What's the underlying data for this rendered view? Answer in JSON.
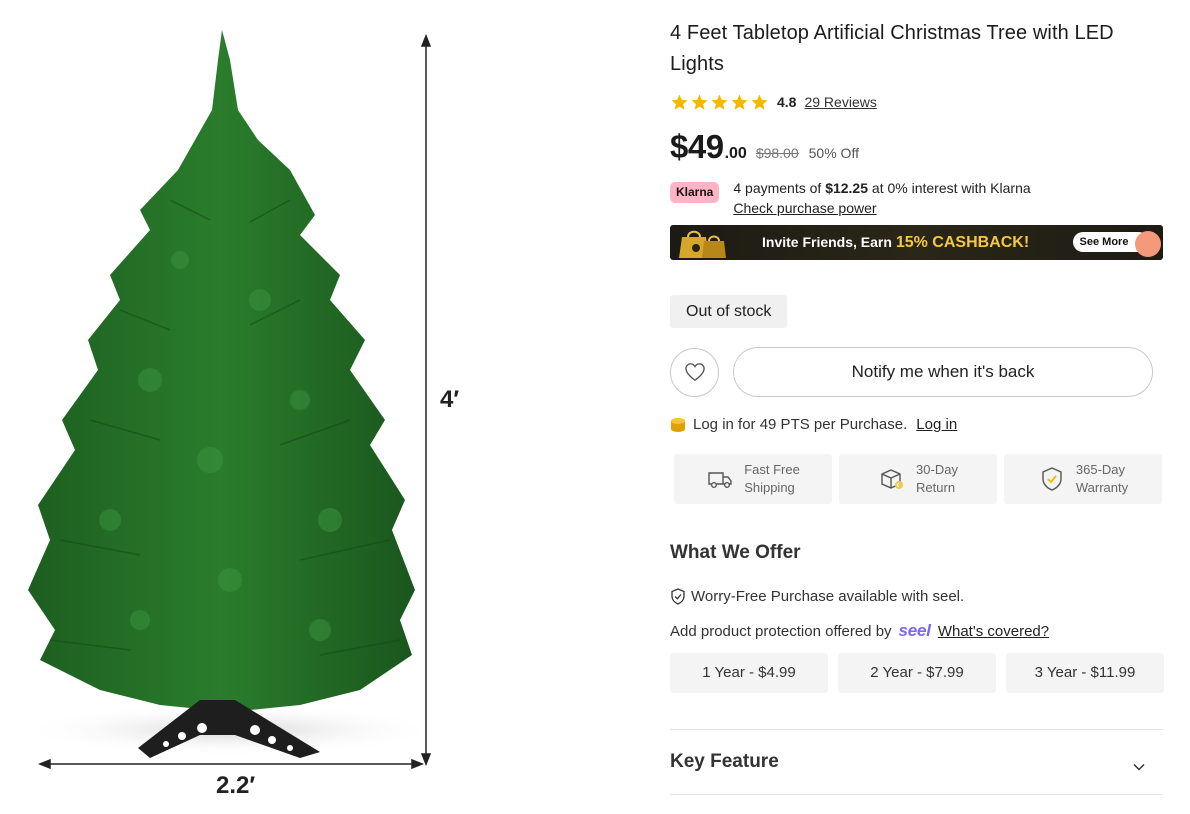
{
  "image": {
    "height_label": "4′",
    "width_label": "2.2′"
  },
  "product": {
    "title": "4 Feet Tabletop Artificial Christmas Tree with LED Lights",
    "rating": "4.8",
    "rating_stars": 5,
    "reviews_link": "29 Reviews",
    "price_main": "$49",
    "price_cents": ".00",
    "price_old": "$98.00",
    "price_off": "50% Off"
  },
  "klarna": {
    "badge": "Klarna",
    "text_prefix": "4 payments of",
    "amount": "$12.25",
    "text_suffix": "at 0% interest with Klarna",
    "link": "Check purchase power"
  },
  "cashback": {
    "text": "Invite Friends, Earn",
    "highlight": "15% CASHBACK!",
    "button": "See More"
  },
  "stock": {
    "status": "Out of stock"
  },
  "actions": {
    "notify": "Notify me when it's back",
    "wishlist_icon": "heart-icon"
  },
  "points": {
    "text": "Log in for 49 PTS per Purchase.",
    "link": "Log in"
  },
  "services": [
    {
      "icon": "truck-icon",
      "line1": "Fast Free",
      "line2": "Shipping"
    },
    {
      "icon": "return-box-icon",
      "line1": "30-Day",
      "line2": "Return"
    },
    {
      "icon": "shield-check-icon",
      "line1": "365-Day",
      "line2": "Warranty"
    }
  ],
  "offer": {
    "heading": "What We Offer",
    "worry_free": "Worry-Free Purchase available with seel.",
    "protection_text": "Add product protection offered by",
    "seel_logo": "seel",
    "covered_link": "What's covered?",
    "plans": [
      "1 Year - $4.99",
      "2 Year - $7.99",
      "3 Year - $11.99"
    ]
  },
  "accordion": {
    "key_feature": "Key Feature"
  },
  "colors": {
    "star": "#f5b800",
    "klarna_pink": "#ffb3c7",
    "seel_purple": "#7b68ee",
    "cashback_gold": "#f5c842",
    "tree_green": "#1f6b22"
  }
}
